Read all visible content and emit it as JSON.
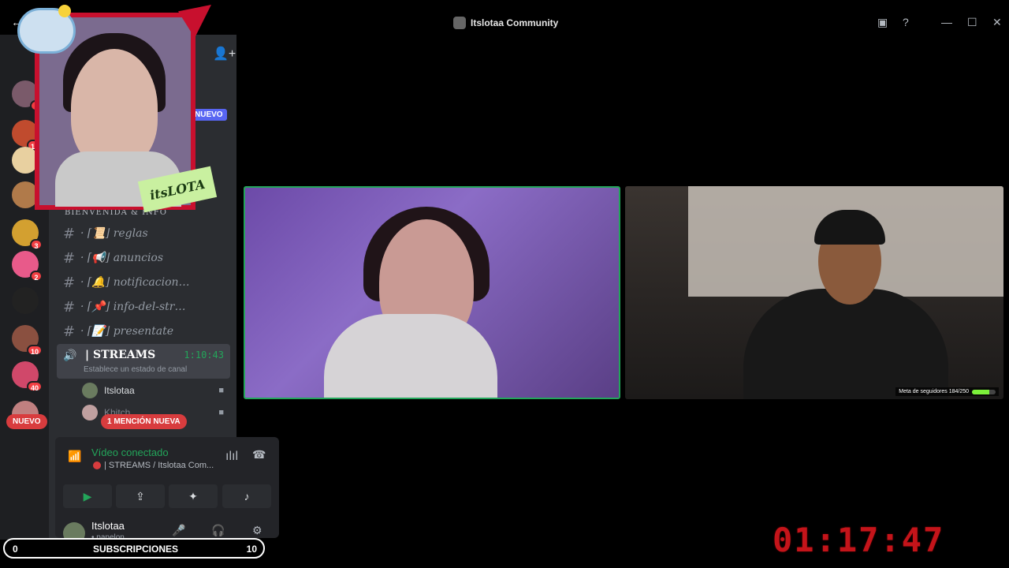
{
  "window": {
    "title": "Itslotaa Community"
  },
  "servers": {
    "badges": [
      "1",
      "18",
      "3",
      "2",
      "10",
      "40"
    ]
  },
  "labels": {
    "nuevo_top": "NUEVO",
    "nuevo_bottom": "NUEVO",
    "mention": "1 MENCIÓN NUEVA"
  },
  "channels": {
    "category": "BIENVENIDA & INFO",
    "items": [
      {
        "hash": "#",
        "name": "· ⌈📜⌋ reglas"
      },
      {
        "hash": "#",
        "name": "· ⌈📢⌋ anuncios"
      },
      {
        "hash": "#",
        "name": "· ⌈🔔⌋ notificacion…"
      },
      {
        "hash": "#",
        "name": "· ⌈📌⌋ info-del-str…"
      },
      {
        "hash": "#",
        "name": "· ⌈📝⌋ presentate"
      }
    ],
    "voice": {
      "name": "| STREAMS",
      "timer": "1:10:43",
      "status": "Establece un estado de canal"
    },
    "members": [
      {
        "name": "Itslotaa"
      },
      {
        "name": "Khitch"
      }
    ]
  },
  "rtc": {
    "connected": "Vídeo conectado",
    "location": "| STREAMS / Itslotaa Com..."
  },
  "user": {
    "name": "Itslotaa",
    "status": "• papelon"
  },
  "overlay": {
    "tag": "itsLOTA"
  },
  "video2": {
    "meta_label": "Meta de seguidores 184/250",
    "meta_progress": 0.736
  },
  "subbar": {
    "left": "0",
    "label": "SUBSCRIPCIONES",
    "right": "10"
  },
  "clock": "01:17:47"
}
